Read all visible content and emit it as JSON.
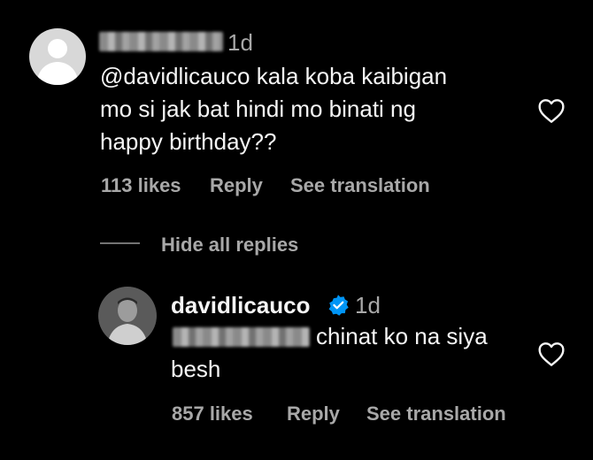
{
  "comment": {
    "time": "1d",
    "text_lines": [
      "@davidlicauco kala koba kaibigan",
      "mo si jak bat hindi mo binati ng",
      "happy birthday??"
    ],
    "likes": "113 likes",
    "reply": "Reply",
    "translate": "See translation"
  },
  "replies_toggle": "Hide all replies",
  "reply": {
    "username": "davidlicauco",
    "time": "1d",
    "text_line1": "chinat ko na siya",
    "text_line2": "besh",
    "likes": "857 likes",
    "reply": "Reply",
    "translate": "See translation"
  },
  "icons": {
    "avatar_default": "default-avatar-icon",
    "verified": "verified-badge-icon",
    "heart": "heart-outline-icon"
  },
  "colors": {
    "background": "#000000",
    "text": "#f5f5f5",
    "muted": "#a8a8a8",
    "verified": "#0095f6"
  }
}
